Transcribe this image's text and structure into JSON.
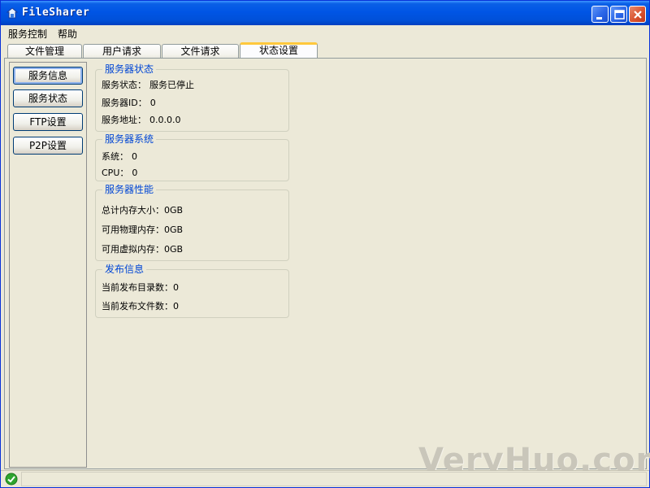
{
  "window": {
    "title": "FileSharer"
  },
  "menu": {
    "items": [
      "服务控制",
      "帮助"
    ]
  },
  "tabs": [
    {
      "label": "文件管理",
      "active": false
    },
    {
      "label": "用户请求",
      "active": false
    },
    {
      "label": "文件请求",
      "active": false
    },
    {
      "label": "状态设置",
      "active": true
    }
  ],
  "sidebar": {
    "buttons": [
      {
        "label": "服务信息",
        "active": true
      },
      {
        "label": "服务状态",
        "active": false
      },
      {
        "label": "FTP设置",
        "active": false
      },
      {
        "label": "P2P设置",
        "active": false
      }
    ]
  },
  "groups": {
    "server_status": {
      "title": "服务器状态",
      "rows": [
        {
          "label": "服务状态：",
          "value": "服务已停止"
        },
        {
          "label": "服务器ID：",
          "value": "0"
        },
        {
          "label": "服务地址：",
          "value": "0.0.0.0"
        }
      ]
    },
    "server_system": {
      "title": "服务器系统",
      "rows": [
        {
          "label": "系统：",
          "value": "0"
        },
        {
          "label": "CPU：",
          "value": "0"
        }
      ]
    },
    "server_performance": {
      "title": "服务器性能",
      "rows": [
        {
          "label": "总计内存大小：",
          "value": "0GB"
        },
        {
          "label": "可用物理内存：",
          "value": "0GB"
        },
        {
          "label": "可用虚拟内存：",
          "value": "0GB"
        }
      ]
    },
    "publish_info": {
      "title": "发布信息",
      "rows": [
        {
          "label": "当前发布目录数：",
          "value": "0"
        },
        {
          "label": "当前发布文件数：",
          "value": "0"
        }
      ]
    }
  },
  "watermark": "VeryHuo.com",
  "icons": {
    "app": "filesharer-icon",
    "status": "check-icon"
  },
  "colors": {
    "titlebar": "#0055e5",
    "group_title": "#0046d5",
    "status_ok": "#2fa52f"
  }
}
